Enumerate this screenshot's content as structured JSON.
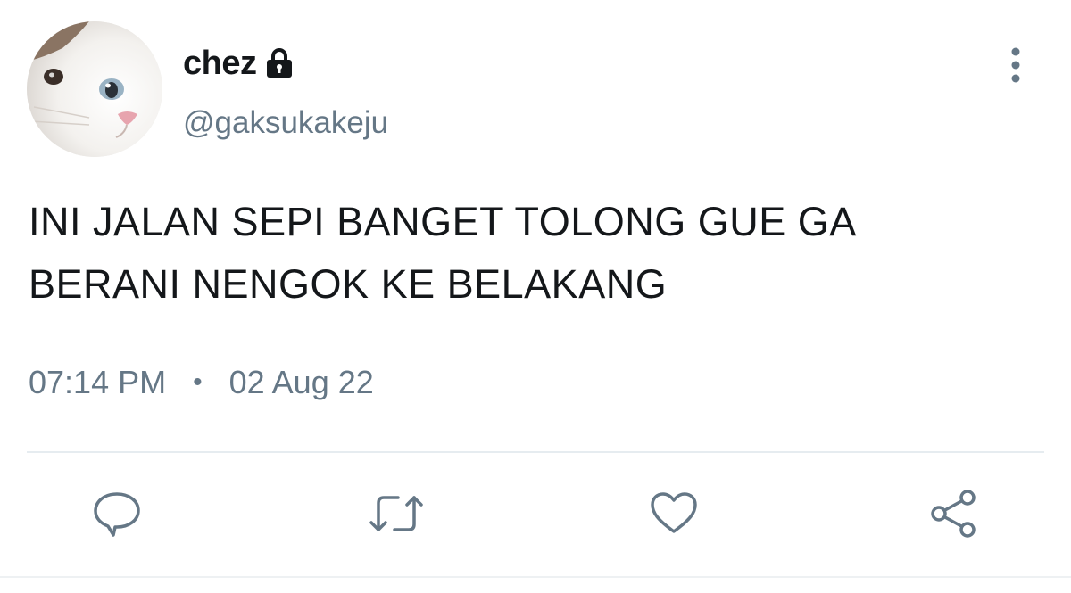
{
  "user": {
    "display_name": "chez",
    "handle": "@gaksukakeju",
    "protected_icon": "lock-icon",
    "avatar": "cat-photo-avatar"
  },
  "tweet": {
    "text": "INI JALAN SEPI BANGET TOLONG GUE GA\nBERANI NENGOK KE BELAKANG",
    "time": "07:14 PM",
    "separator": "•",
    "date": "02 Aug 22"
  },
  "actions": [
    {
      "name": "reply",
      "icon": "speech-bubble-icon"
    },
    {
      "name": "retweet",
      "icon": "retweet-icon"
    },
    {
      "name": "like",
      "icon": "heart-icon"
    },
    {
      "name": "share",
      "icon": "share-icon"
    }
  ],
  "colors": {
    "text_primary": "#14171a",
    "text_secondary": "#657786",
    "icon": "#657786",
    "divider": "#e6ecf0"
  }
}
